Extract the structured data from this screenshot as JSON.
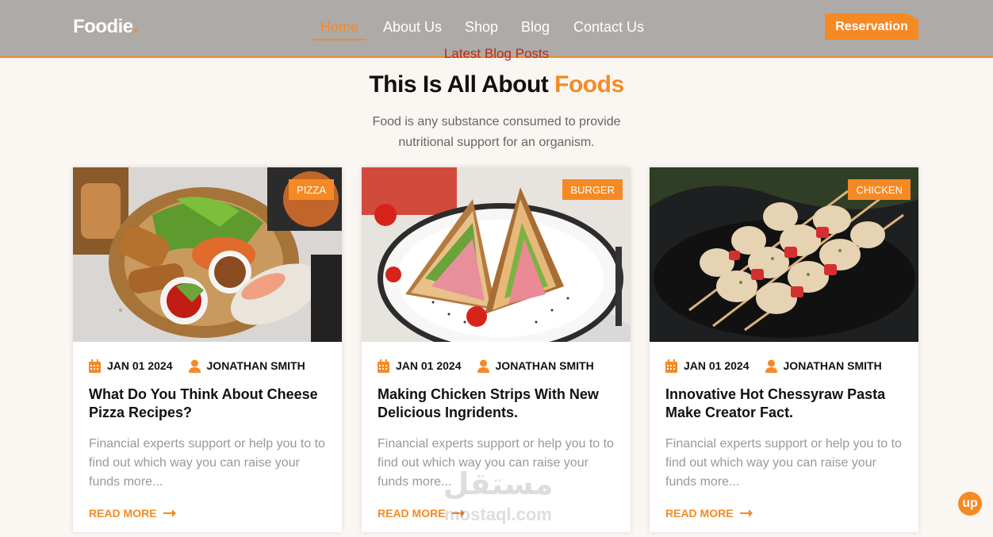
{
  "brand": {
    "name": "Foodie",
    "dot": "."
  },
  "nav": {
    "items": [
      "Home",
      "About Us",
      "Shop",
      "Blog",
      "Contact Us"
    ],
    "active": "Home",
    "cta": "Reservation"
  },
  "section": {
    "kicker": "Latest Blog Posts",
    "title_main": "This Is All About ",
    "title_accent": "Foods",
    "desc_line1": "Food is any substance consumed to provide",
    "desc_line2": "nutritional support for an organism."
  },
  "posts": [
    {
      "tag": "PIZZA",
      "date": "JAN 01 2024",
      "author": "JONATHAN SMITH",
      "title": "What Do You Think About Cheese Pizza Recipes?",
      "excerpt": "Financial experts support or help you to to find out which way you can raise your funds more...",
      "cta": "READ MORE",
      "image_icon": "spring-rolls-photo"
    },
    {
      "tag": "BURGER",
      "date": "JAN 01 2024",
      "author": "JONATHAN SMITH",
      "title": "Making Chicken Strips With New Delicious Ingridents.",
      "excerpt": "Financial experts support or help you to to find out which way you can raise your funds more...",
      "cta": "READ MORE",
      "image_icon": "sandwich-photo"
    },
    {
      "tag": "CHICKEN",
      "date": "JAN 01 2024",
      "author": "JONATHAN SMITH",
      "title": "Innovative Hot Chessyraw Pasta Make Creator Fact.",
      "excerpt": "Financial experts support or help you to to find out which way you can raise your funds more...",
      "cta": "READ MORE",
      "image_icon": "chicken-skewers-photo"
    }
  ],
  "watermark": {
    "arabic": "مستقل",
    "latin": "mostaql.com"
  },
  "back_to_top": "up",
  "colors": {
    "accent": "#f58a25",
    "nav_bg": "#aeaaa8",
    "page_bg": "#faf6f2",
    "kicker": "#b52b1e"
  }
}
